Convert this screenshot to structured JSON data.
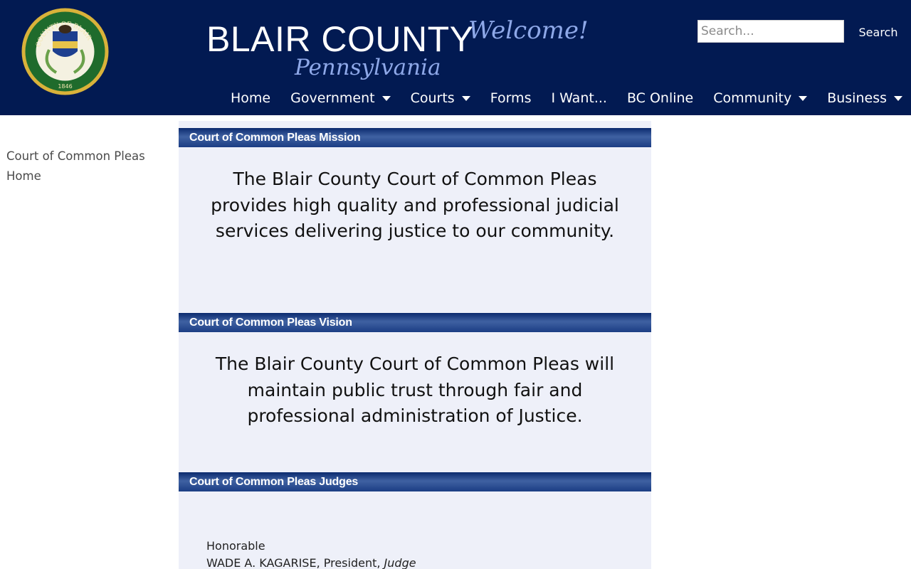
{
  "header": {
    "seal_text_top": "COUNTY OF BLAIR",
    "seal_year": "1846",
    "title": "BLAIR COUNTY",
    "state": "Pennsylvania",
    "welcome": "Welcome!",
    "colors": {
      "background": "#021a52",
      "accent": "#8ea8e8"
    }
  },
  "search": {
    "placeholder": "Search...",
    "value": "",
    "button_label": "Search"
  },
  "nav": {
    "items": [
      {
        "label": "Home",
        "dropdown": false
      },
      {
        "label": "Government",
        "dropdown": true
      },
      {
        "label": "Courts",
        "dropdown": true
      },
      {
        "label": "Forms",
        "dropdown": false
      },
      {
        "label": "I Want...",
        "dropdown": false
      },
      {
        "label": "BC Online",
        "dropdown": false
      },
      {
        "label": "Community",
        "dropdown": true
      },
      {
        "label": "Business",
        "dropdown": true
      }
    ]
  },
  "sidebar": {
    "items": [
      {
        "label": "Court of Common Pleas Home"
      }
    ]
  },
  "main": {
    "sections": [
      {
        "title": "Court of Common Pleas Mission",
        "text": "The Blair County Court of Common Pleas provides high quality and professional judicial services delivering justice to our community."
      },
      {
        "title": "Court of Common Pleas Vision",
        "text": "The Blair County Court of Common Pleas will maintain public trust through fair and professional administration of Justice."
      },
      {
        "title": "Court of Common Pleas Judges",
        "judges": [
          {
            "honorific": "Honorable",
            "name": "WADE A. KAGARISE, President,",
            "title": "Judge"
          }
        ]
      }
    ],
    "colors": {
      "panel": "#eef0f9",
      "bar": "#1b3d84"
    }
  }
}
